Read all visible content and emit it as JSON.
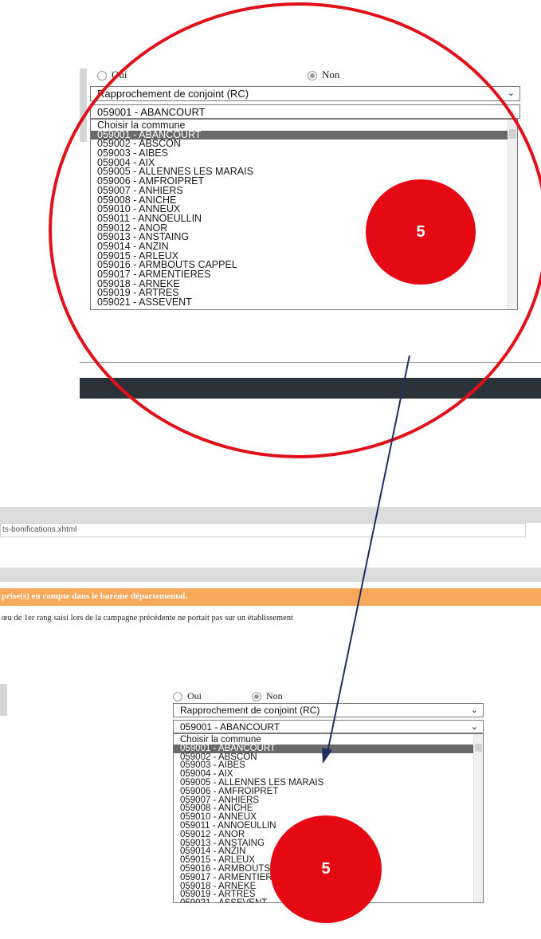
{
  "form": {
    "radio_oui": "Oui",
    "radio_non": "Non",
    "reason_select": "Rapprochement de conjoint (RC)",
    "commune_select": "059001 - ABANCOURT",
    "commune_options": [
      "Choisir la commune",
      "059001 - ABANCOURT",
      "059002 - ABSCON",
      "059003 - AIBES",
      "059004 - AIX",
      "059005 - ALLENNES LES MARAIS",
      "059006 - AMFROIPRET",
      "059007 - ANHIERS",
      "059008 - ANICHE",
      "059010 - ANNEUX",
      "059011 - ANNOEULLIN",
      "059012 - ANOR",
      "059013 - ANSTAING",
      "059014 - ANZIN",
      "059015 - ARLEUX",
      "059016 - ARMBOUTS CAPPEL",
      "059017 - ARMENTIERES",
      "059018 - ARNEKE",
      "059019 - ARTRES",
      "059021 - ASSEVENT"
    ],
    "selected_index": 1
  },
  "annotation": {
    "step_number": "5",
    "marker_color": "#e50914",
    "arrow_color": "#1f2f5f"
  },
  "page": {
    "url_fragment": "ts-bonifications.xhtml",
    "banner_text": "prise(s) en compte dans le barème départemental.",
    "banner_color": "#f7a85a",
    "info_text": "œu de 1er rang saisi lors de la campagne précédente ne portait pas sur un établissement"
  }
}
